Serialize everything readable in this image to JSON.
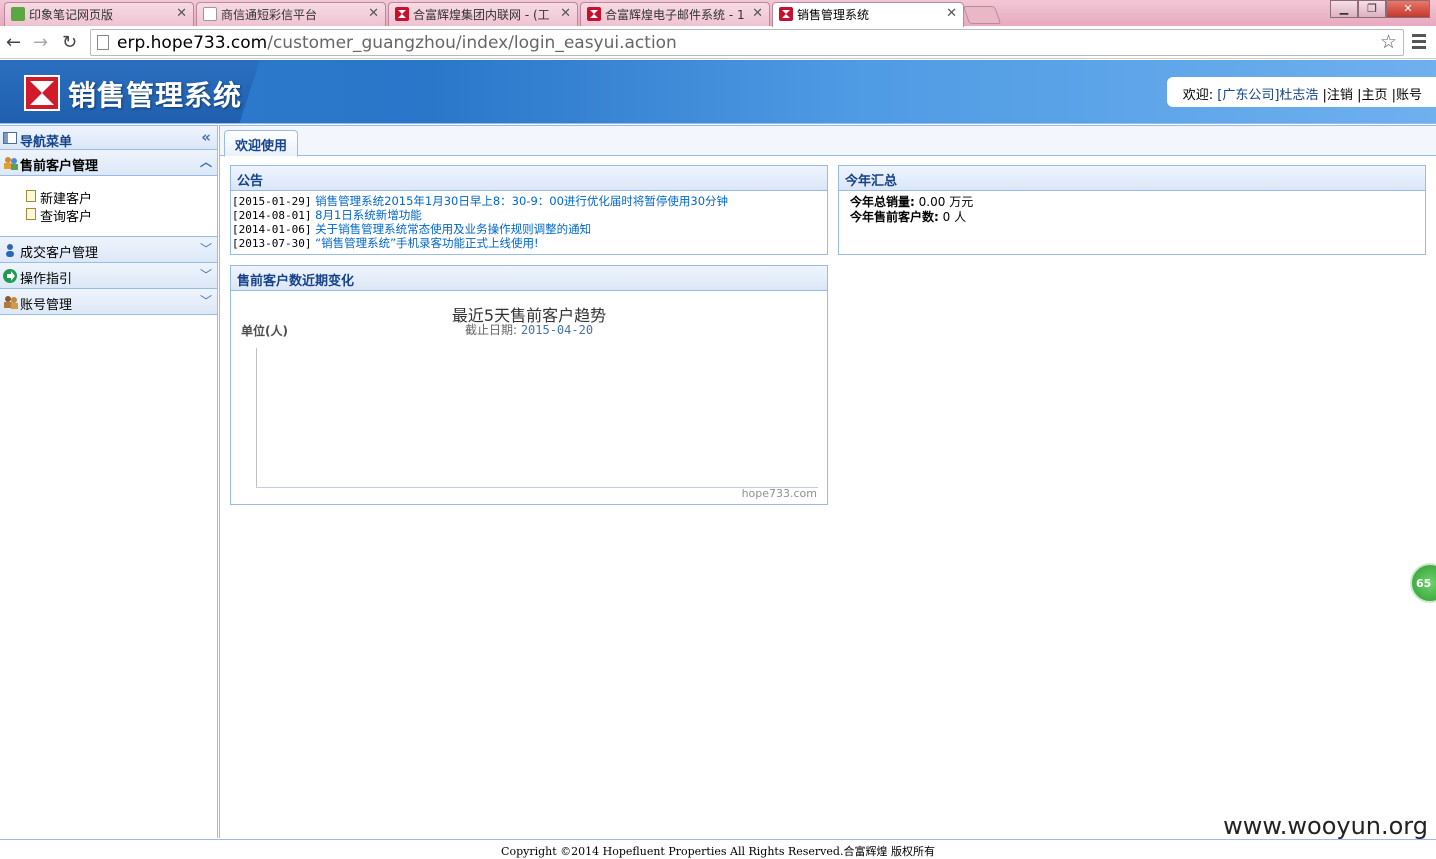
{
  "browser": {
    "tabs": [
      {
        "title": "印象笔记网页版",
        "icon": "evernote-icon"
      },
      {
        "title": "商信通短彩信平台",
        "icon": "page-icon"
      },
      {
        "title": "合富辉煌集团内联网 - (工",
        "icon": "hope-logo-icon"
      },
      {
        "title": "合富辉煌电子邮件系统 - 1",
        "icon": "hope-logo-icon"
      },
      {
        "title": "销售管理系统",
        "icon": "hope-logo-icon"
      }
    ],
    "active_tab": 4,
    "url_host": "erp.hope733.com",
    "url_path": "/customer_guangzhou/index/login_easyui.action"
  },
  "header": {
    "title": "销售管理系统",
    "welcome_label": "欢迎:",
    "user": "[广东公司]杜志浩",
    "links": [
      "|注销",
      "|主页",
      "|账号"
    ]
  },
  "sidebar": {
    "title": "导航菜单",
    "sections": [
      {
        "label": "售前客户管理",
        "open": true,
        "items": [
          "新建客户",
          "查询客户"
        ]
      },
      {
        "label": "成交客户管理",
        "open": false
      },
      {
        "label": "操作指引",
        "open": false
      },
      {
        "label": "账号管理",
        "open": false
      }
    ]
  },
  "main": {
    "tab": "欢迎使用",
    "notice": {
      "title": "公告",
      "items": [
        {
          "date": "[2015-01-29]",
          "text": "销售管理系统2015年1月30日早上8：30-9：00进行优化届时将暂停使用30分钟"
        },
        {
          "date": "[2014-08-01]",
          "text": "8月1日系统新增功能"
        },
        {
          "date": "[2014-01-06]",
          "text": "关于销售管理系统常态使用及业务操作规则调整的通知"
        },
        {
          "date": "[2013-07-30]",
          "text": "“销售管理系统”手机录客功能正式上线使用!"
        }
      ]
    },
    "summary": {
      "title": "今年汇总",
      "sales_label": "今年总销量:",
      "sales_value": "0.00",
      "sales_unit": "万元",
      "customers_label": "今年售前客户数:",
      "customers_value": "0",
      "customers_unit": "人"
    },
    "trend": {
      "title": "售前客户数近期变化"
    }
  },
  "chart_data": {
    "type": "line",
    "title": "最近5天售前客户趋势",
    "subtitle_label": "截止日期:",
    "subtitle_value": "2015-04-20",
    "ylabel": "单位(人)",
    "series": [],
    "credit": "hope733.com"
  },
  "footer": {
    "copyright": "Copyright ©2014 Hopefluent Properties All Rights Reserved.合富辉煌 版权所有"
  },
  "watermark": "www.wooyun.org",
  "float_badge": "65"
}
